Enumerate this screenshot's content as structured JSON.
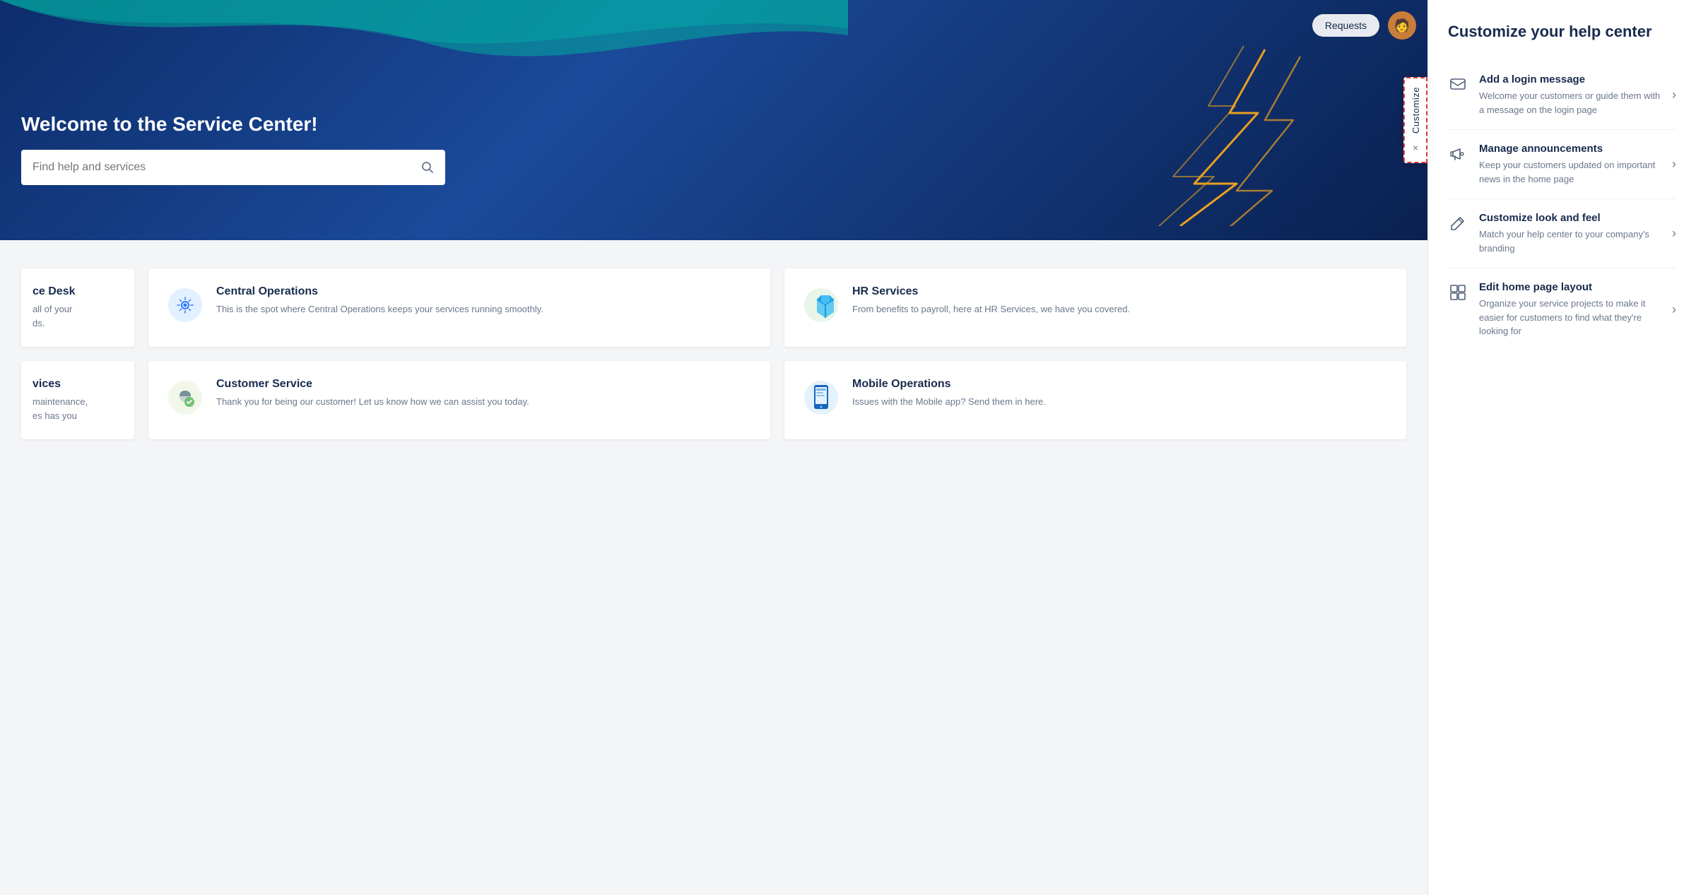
{
  "hero": {
    "title": "Welcome to the Service Center!",
    "search_placeholder": "Find help and services",
    "requests_button": "Requests"
  },
  "customize_tab": {
    "label": "Customize",
    "close": "×"
  },
  "cards": [
    {
      "id": "it-service-desk",
      "partial": true,
      "title": "ce Desk",
      "desc": "all of your ds."
    },
    {
      "id": "central-operations",
      "partial": false,
      "title": "Central Operations",
      "desc": "This is the spot where Central Operations keeps your services running smoothly.",
      "icon": "gear"
    },
    {
      "id": "hr-services",
      "partial": false,
      "title": "HR Services",
      "desc": "From benefits to payroll, here at HR Services, we have you covered.",
      "icon": "people"
    }
  ],
  "cards_row2": [
    {
      "id": "it-services2",
      "partial": true,
      "title": "vices",
      "desc": "maintenance, es has you"
    },
    {
      "id": "customer-service",
      "partial": false,
      "title": "Customer Service",
      "desc": "Thank you for being our customer! Let us know how we can assist you today.",
      "icon": "shield"
    },
    {
      "id": "mobile-operations",
      "partial": false,
      "title": "Mobile Operations",
      "desc": "Issues with the Mobile app? Send them in here.",
      "icon": "mobile"
    }
  ],
  "right_panel": {
    "title": "Customize your help center",
    "items": [
      {
        "id": "add-login-message",
        "title": "Add a login message",
        "desc": "Welcome your customers or guide them with a message on the login page",
        "icon": "message"
      },
      {
        "id": "manage-announcements",
        "title": "Manage announcements",
        "desc": "Keep your customers updated on important news in the home page",
        "icon": "megaphone"
      },
      {
        "id": "customize-look",
        "title": "Customize look and feel",
        "desc": "Match your help center to your company's branding",
        "icon": "pencil"
      },
      {
        "id": "edit-home-layout",
        "title": "Edit home page layout",
        "desc": "Organize your service projects to make it easier for customers to find what they're looking for",
        "icon": "grid"
      }
    ]
  }
}
